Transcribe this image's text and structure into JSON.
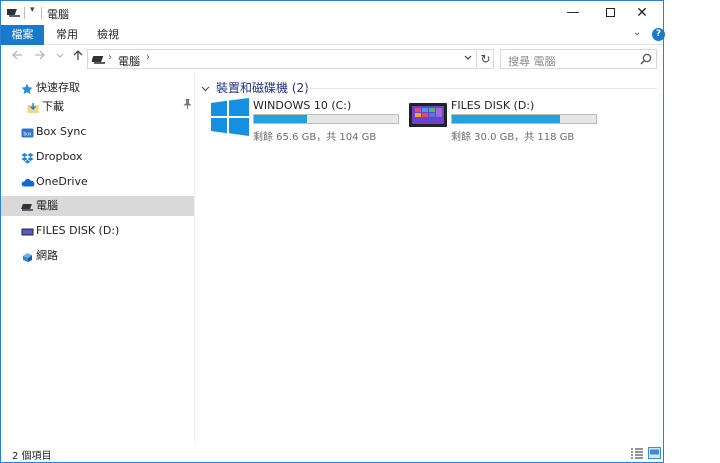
{
  "window": {
    "title": "電腦",
    "quick_access_dropdown": "▾",
    "controls": {
      "minimize": "—",
      "close": "✕"
    }
  },
  "ribbon": {
    "tabs": [
      "檔案",
      "常用",
      "檢視"
    ],
    "expand": "⌄",
    "help": "?"
  },
  "address": {
    "path": "電腦",
    "search_placeholder": "搜尋 電腦"
  },
  "navigation": {
    "items": [
      {
        "label": "快速存取",
        "icon": "star-icon"
      },
      {
        "label": "下載",
        "icon": "download-folder-icon",
        "pinned": true
      },
      {
        "label": "Box Sync",
        "icon": "box-sync-icon"
      },
      {
        "label": "Dropbox",
        "icon": "dropbox-icon"
      },
      {
        "label": "OneDrive",
        "icon": "onedrive-icon"
      },
      {
        "label": "電腦",
        "icon": "computer-icon",
        "selected": true
      },
      {
        "label": "FILES DISK (D:)",
        "icon": "drive-icon"
      },
      {
        "label": "網路",
        "icon": "network-icon"
      }
    ]
  },
  "content": {
    "group_header": "裝置和磁碟機 (2)",
    "drives": [
      {
        "name": "WINDOWS 10 (C:)",
        "free_text": "剩餘 65.6 GB，共 104 GB",
        "used_fraction": 0.37,
        "icon": "windows-logo-icon"
      },
      {
        "name": "FILES DISK (D:)",
        "free_text": "剩餘 30.0 GB，共 118 GB",
        "used_fraction": 0.75,
        "icon": "tablet-drive-icon"
      }
    ]
  },
  "status": {
    "item_count": "2 個項目"
  },
  "colors": {
    "accent": "#1979ca",
    "capacity_bar": "#26a0da",
    "selection": "#d9d9d9",
    "group_header": "#1e3287"
  }
}
